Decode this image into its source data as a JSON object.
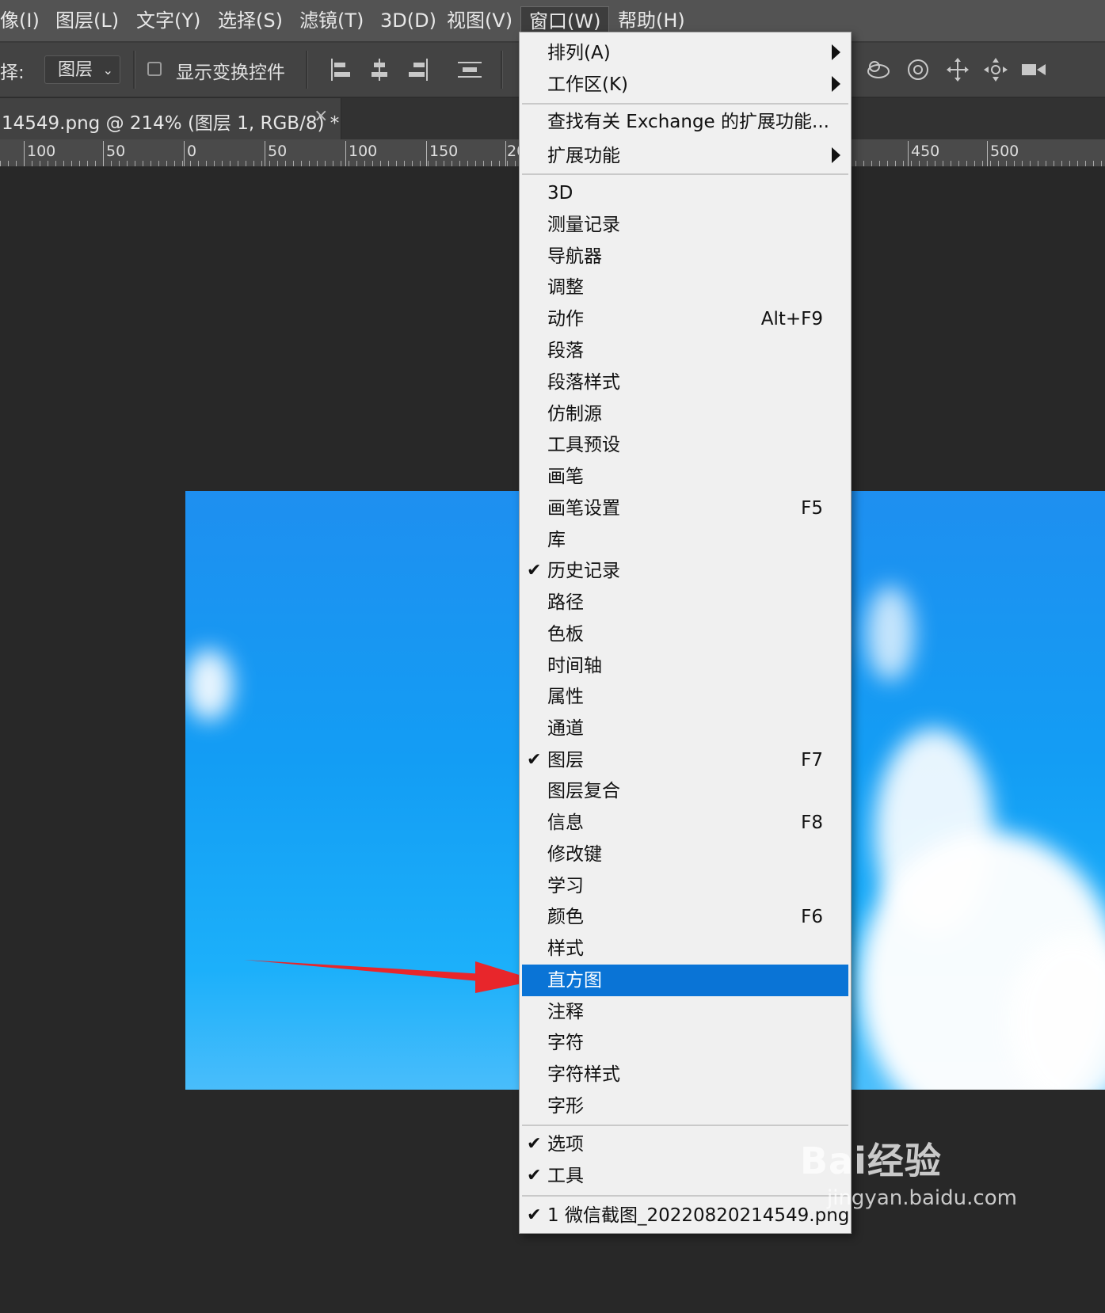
{
  "menubar": {
    "items": [
      "像(I)",
      "图层(L)",
      "文字(Y)",
      "选择(S)",
      "滤镜(T)",
      "3D(D)",
      "视图(V)",
      "窗口(W)",
      "帮助(H)"
    ]
  },
  "options_bar": {
    "select_prefix": "择:",
    "select_value": "图层",
    "transform_controls_label": "显示变换控件"
  },
  "document_tab": {
    "title": "14549.png @ 214% (图层 1, RGB/8) *",
    "close": "×"
  },
  "ruler": {
    "labels": [
      "100",
      "50",
      "0",
      "50",
      "100",
      "150",
      "20",
      "450",
      "500"
    ]
  },
  "window_menu": {
    "groups": [
      [
        {
          "label": "排列(A)",
          "submenu": true
        },
        {
          "label": "工作区(K)",
          "submenu": true
        }
      ],
      [
        {
          "label": "查找有关 Exchange 的扩展功能..."
        },
        {
          "label": "扩展功能",
          "submenu": true
        }
      ],
      [
        {
          "label": "3D"
        },
        {
          "label": "测量记录"
        },
        {
          "label": "导航器"
        },
        {
          "label": "调整"
        },
        {
          "label": "动作",
          "shortcut": "Alt+F9"
        },
        {
          "label": "段落"
        },
        {
          "label": "段落样式"
        },
        {
          "label": "仿制源"
        },
        {
          "label": "工具预设"
        },
        {
          "label": "画笔"
        },
        {
          "label": "画笔设置",
          "shortcut": "F5"
        },
        {
          "label": "库"
        },
        {
          "label": "历史记录",
          "checked": true
        },
        {
          "label": "路径"
        },
        {
          "label": "色板"
        },
        {
          "label": "时间轴"
        },
        {
          "label": "属性"
        },
        {
          "label": "通道"
        },
        {
          "label": "图层",
          "shortcut": "F7",
          "checked": true
        },
        {
          "label": "图层复合"
        },
        {
          "label": "信息",
          "shortcut": "F8"
        },
        {
          "label": "修改键"
        },
        {
          "label": "学习"
        },
        {
          "label": "颜色",
          "shortcut": "F6"
        },
        {
          "label": "样式"
        },
        {
          "label": "直方图",
          "highlighted": true
        },
        {
          "label": "注释"
        },
        {
          "label": "字符"
        },
        {
          "label": "字符样式"
        },
        {
          "label": "字形"
        }
      ],
      [
        {
          "label": "选项",
          "checked": true
        },
        {
          "label": "工具",
          "checked": true
        }
      ],
      [
        {
          "label": "1 微信截图_20220820214549.png",
          "checked": true
        }
      ]
    ]
  },
  "watermark": {
    "brand": "Bai经验",
    "url": "jingyan.baidu.com"
  },
  "colors": {
    "highlight": "#0a74d6",
    "arrow": "#e8262b",
    "menu_bg": "#f0f0f0"
  }
}
